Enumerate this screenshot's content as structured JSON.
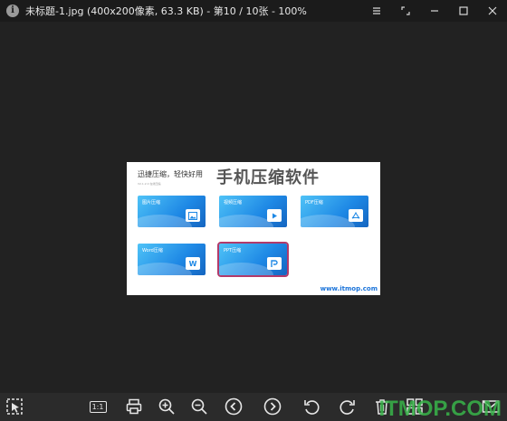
{
  "window": {
    "title": "未标题-1.jpg (400x200像素, 63.3 KB) - 第10 / 10张 - 100%",
    "controls": [
      "menu-icon",
      "fullscreen-icon",
      "minimize-icon",
      "maximize-icon",
      "close-icon"
    ]
  },
  "image": {
    "header": "迅捷压缩，轻快好用",
    "version": "V2.1.2.0    在线压缩",
    "big_title": "手机压缩软件",
    "cards": [
      {
        "label": "图片压缩",
        "icon": "image-icon"
      },
      {
        "label": "视频压缩",
        "icon": "play-icon"
      },
      {
        "label": "PDF压缩",
        "icon": "pdf-icon"
      },
      {
        "label": "Word压缩",
        "icon": "word-icon",
        "glyph": "W"
      },
      {
        "label": "PPT压缩",
        "icon": "ppt-icon"
      }
    ],
    "url": "www.itmop.com"
  },
  "toolbar": {
    "actual_size_label": "1:1",
    "tools": [
      "select-icon",
      "actual-size",
      "print-icon",
      "zoom-in-icon",
      "zoom-out-icon",
      "previous-icon",
      "next-icon",
      "rotate-left-icon",
      "rotate-right-icon",
      "delete-icon",
      "thumbnails-icon",
      "mail-icon"
    ]
  },
  "watermark": "ITMOP.COM",
  "colors": {
    "titlebar": "#1b1b1b",
    "viewer": "#222222",
    "toolbar": "#2b2b2b",
    "card_blue": "#1e88e5",
    "url_blue": "#1a73d9",
    "watermark_green": "#39b54a"
  }
}
